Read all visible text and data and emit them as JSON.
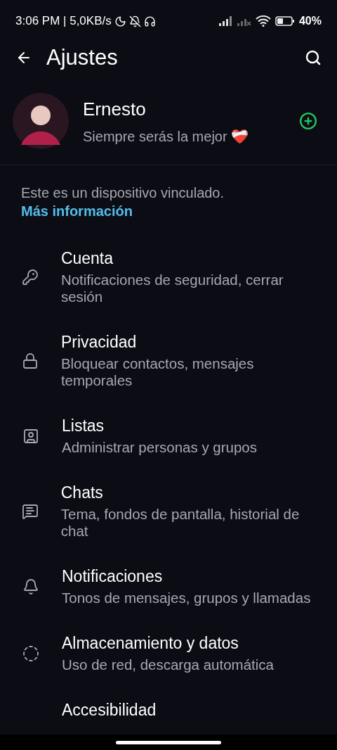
{
  "status_bar": {
    "time": "3:06 PM | 5,0KB/s",
    "battery": "40%"
  },
  "app_bar": {
    "title": "Ajustes"
  },
  "profile": {
    "name": "Ernesto",
    "about": "Siempre serás la mejor ❤️‍🩹"
  },
  "linked_notice": {
    "text": "Este es un dispositivo vinculado.",
    "link": "Más información"
  },
  "settings": [
    {
      "kind": "key",
      "title": "Cuenta",
      "subtitle": "Notificaciones de seguridad, cerrar sesión"
    },
    {
      "kind": "lock",
      "title": "Privacidad",
      "subtitle": "Bloquear contactos, mensajes temporales"
    },
    {
      "kind": "lists",
      "title": "Listas",
      "subtitle": "Administrar personas y grupos"
    },
    {
      "kind": "chat",
      "title": "Chats",
      "subtitle": "Tema, fondos de pantalla, historial de chat"
    },
    {
      "kind": "bell",
      "title": "Notificaciones",
      "subtitle": "Tonos de mensajes, grupos y llamadas"
    },
    {
      "kind": "storage",
      "title": "Almacenamiento y datos",
      "subtitle": "Uso de red, descarga automática"
    },
    {
      "kind": "none",
      "title": "Accesibilidad"
    }
  ]
}
